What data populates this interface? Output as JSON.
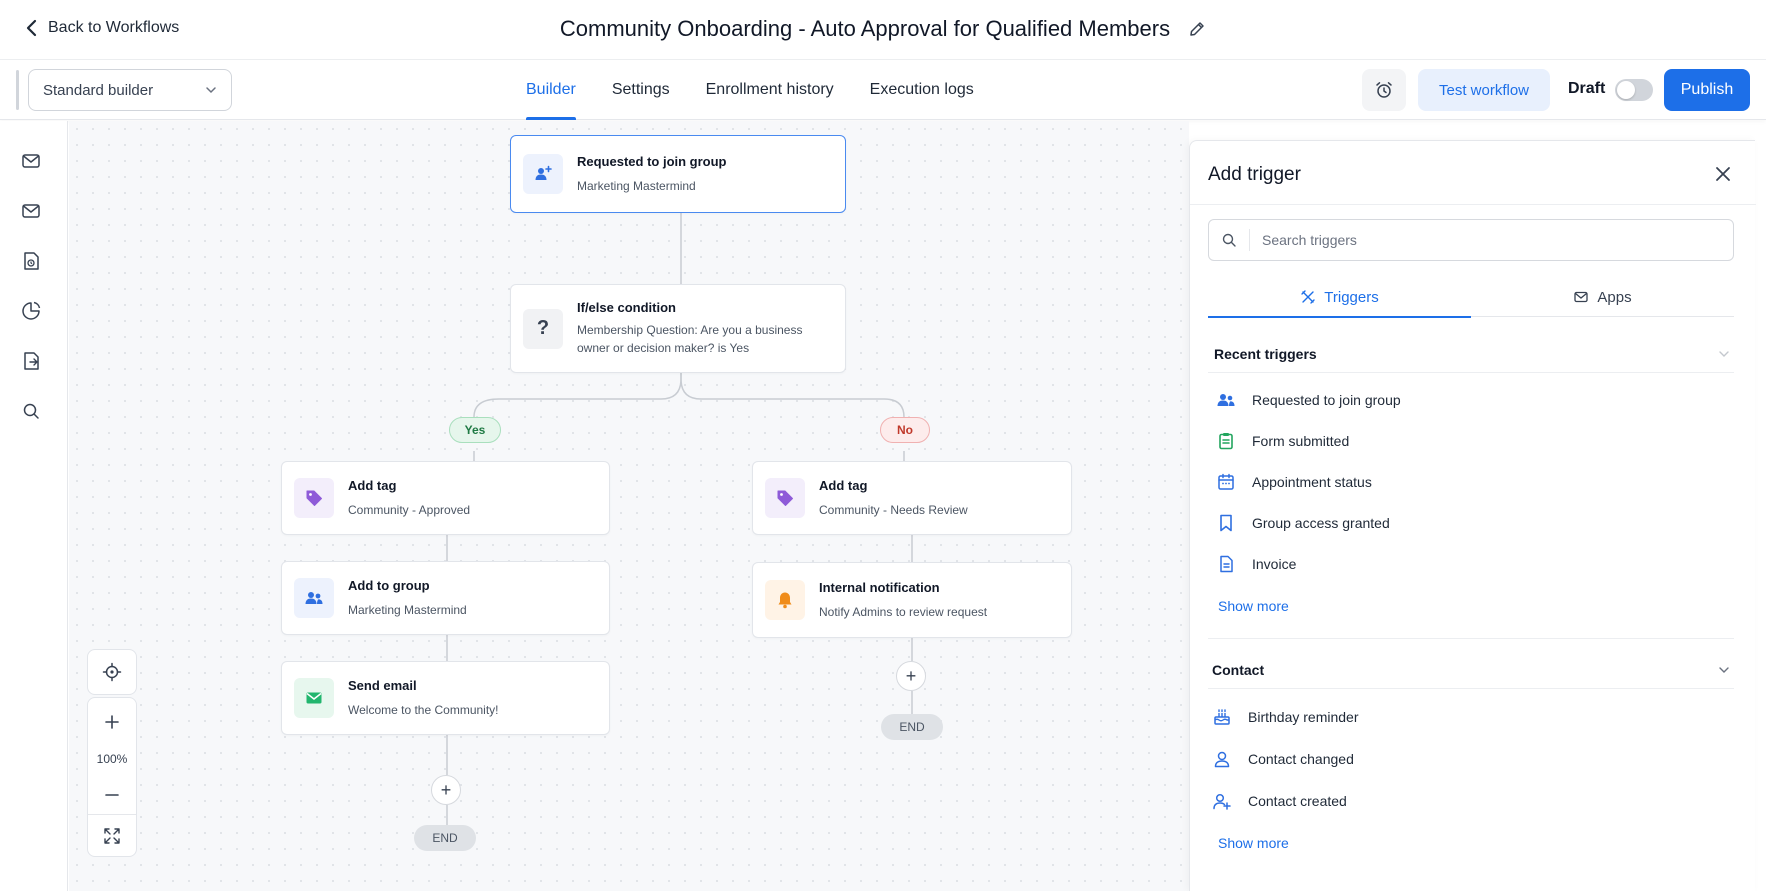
{
  "header": {
    "back_label": "Back to Workflows",
    "workflow_title": "Community Onboarding - Auto Approval for Qualified Members"
  },
  "toolbar": {
    "builder_mode": "Standard builder",
    "tabs": [
      "Builder",
      "Settings",
      "Enrollment history",
      "Execution logs"
    ],
    "active_tab": "Builder",
    "test_label": "Test workflow",
    "status_label": "Draft",
    "status_toggle_on": false,
    "publish_label": "Publish"
  },
  "sidebar": {
    "icons": [
      "mail-icon",
      "mail-icon",
      "file-clock-icon",
      "pie-chart-icon",
      "file-export-icon",
      "search-icon"
    ]
  },
  "canvas": {
    "trigger": {
      "title": "Requested to join group",
      "subtitle": "Marketing Mastermind",
      "icon": "users-icon"
    },
    "condition": {
      "title": "If/else condition",
      "subtitle": "Membership Question: Are you a business owner or decision maker? is Yes",
      "icon": "question-icon"
    },
    "branch_yes_label": "Yes",
    "branch_no_label": "No",
    "yes_steps": [
      {
        "title": "Add tag",
        "subtitle": "Community - Approved",
        "icon": "tag-icon"
      },
      {
        "title": "Add to group",
        "subtitle": "Marketing Mastermind",
        "icon": "users-icon"
      },
      {
        "title": "Send email",
        "subtitle": "Welcome to the Community!",
        "icon": "mail-icon"
      }
    ],
    "no_steps": [
      {
        "title": "Add tag",
        "subtitle": "Community - Needs Review",
        "icon": "tag-icon"
      },
      {
        "title": "Internal notification",
        "subtitle": "Notify Admins to review request",
        "icon": "bell-icon"
      }
    ],
    "add_symbol": "+",
    "end_label": "END",
    "zoom_level": "100%"
  },
  "panel": {
    "title": "Add trigger",
    "search_placeholder": "Search triggers",
    "tabs": [
      "Triggers",
      "Apps"
    ],
    "active_tab": "Triggers",
    "recent_section": {
      "title": "Recent triggers",
      "items": [
        {
          "label": "Requested to join group",
          "icon": "users-icon"
        },
        {
          "label": "Form submitted",
          "icon": "clipboard-icon"
        },
        {
          "label": "Appointment status",
          "icon": "calendar-icon"
        },
        {
          "label": "Group access granted",
          "icon": "bookmark-icon"
        },
        {
          "label": "Invoice",
          "icon": "invoice-icon"
        }
      ],
      "show_more": "Show more"
    },
    "contact_section": {
      "title": "Contact",
      "items": [
        {
          "label": "Birthday reminder",
          "icon": "cake-icon"
        },
        {
          "label": "Contact changed",
          "icon": "user-icon"
        },
        {
          "label": "Contact created",
          "icon": "user-plus-icon"
        }
      ],
      "show_more": "Show more"
    }
  },
  "colors": {
    "accent": "#1d6fe8",
    "yes_green": "#1f7a44",
    "no_red": "#c0392b",
    "tag_purple": "#8e5bd8",
    "bell_orange": "#f08c1a",
    "email_green": "#22b66e"
  }
}
